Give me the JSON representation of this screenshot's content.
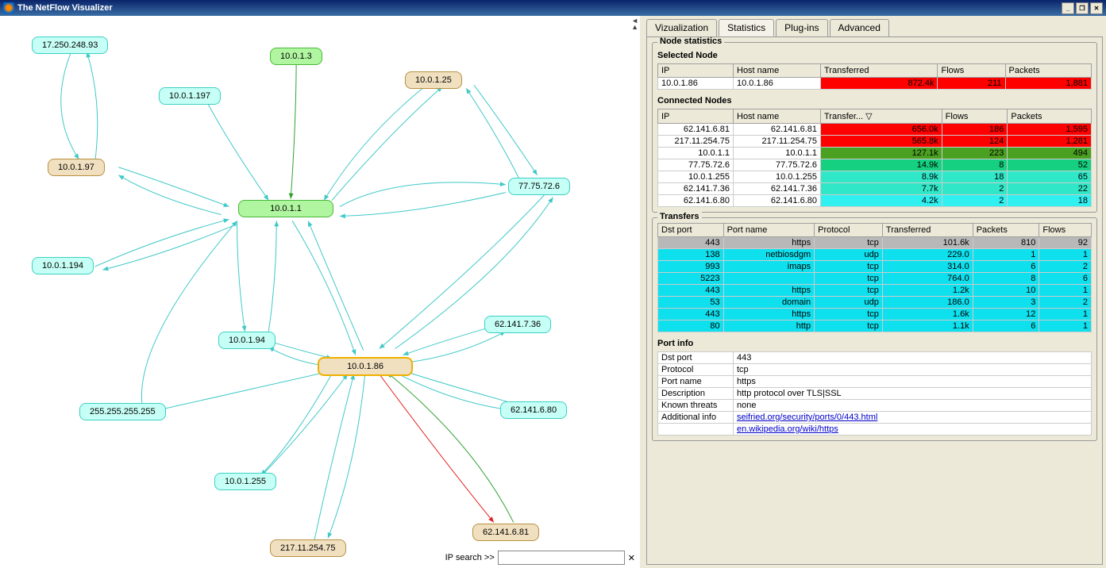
{
  "window": {
    "title": "The NetFlow Visualizer"
  },
  "tabs": {
    "vizualization": "Vizualization",
    "statistics": "Statistics",
    "plugins": "Plug-ins",
    "advanced": "Advanced",
    "active": "Statistics"
  },
  "nodeStats": {
    "title": "Node statistics",
    "selectedTitle": "Selected Node",
    "headers": {
      "ip": "IP",
      "host": "Host name",
      "transferred": "Transferred",
      "flows": "Flows",
      "packets": "Packets"
    },
    "selected": {
      "ip": "10.0.1.86",
      "host": "10.0.1.86",
      "transferred": "872.4k",
      "flows": "211",
      "packets": "1,881",
      "bg": "#ff0000"
    },
    "connectedTitle": "Connected Nodes",
    "connHeaders": {
      "ip": "IP",
      "host": "Host name",
      "transfer": "Transfer... ▽",
      "flows": "Flows",
      "packets": "Packets"
    },
    "connected": [
      {
        "ip": "62.141.6.81",
        "host": "62.141.6.81",
        "transfer": "656.0k",
        "flows": "186",
        "packets": "1,595",
        "bg": "#ff0000"
      },
      {
        "ip": "217.11.254.75",
        "host": "217.11.254.75",
        "transfer": "565.8k",
        "flows": "124",
        "packets": "1,281",
        "bg": "#ff0000"
      },
      {
        "ip": "10.0.1.1",
        "host": "10.0.1.1",
        "transfer": "127.1k",
        "flows": "223",
        "packets": "494",
        "bg": "#4aa020"
      },
      {
        "ip": "77.75.72.6",
        "host": "77.75.72.6",
        "transfer": "14.9k",
        "flows": "8",
        "packets": "52",
        "bg": "#14d080"
      },
      {
        "ip": "10.0.1.255",
        "host": "10.0.1.255",
        "transfer": "8.9k",
        "flows": "18",
        "packets": "65",
        "bg": "#30e8c8"
      },
      {
        "ip": "62.141.7.36",
        "host": "62.141.7.36",
        "transfer": "7.7k",
        "flows": "2",
        "packets": "22",
        "bg": "#30e8c8"
      },
      {
        "ip": "62.141.6.80",
        "host": "62.141.6.80",
        "transfer": "4.2k",
        "flows": "2",
        "packets": "18",
        "bg": "#30f0f0"
      }
    ]
  },
  "transfers": {
    "title": "Transfers",
    "headers": {
      "dst": "Dst port",
      "pname": "Port name",
      "proto": "Protocol",
      "transferred": "Transferred",
      "packets": "Packets",
      "flows": "Flows"
    },
    "rows": [
      {
        "dst": "443",
        "pname": "https",
        "proto": "tcp",
        "transferred": "101.6k",
        "packets": "810",
        "flows": "92",
        "bg": "#b8b8b8"
      },
      {
        "dst": "138",
        "pname": "netbiosdgm",
        "proto": "udp",
        "transferred": "229.0",
        "packets": "1",
        "flows": "1",
        "bg": "#0ee0ee"
      },
      {
        "dst": "993",
        "pname": "imaps",
        "proto": "tcp",
        "transferred": "314.0",
        "packets": "6",
        "flows": "2",
        "bg": "#0ee0ee"
      },
      {
        "dst": "5223",
        "pname": "",
        "proto": "tcp",
        "transferred": "764.0",
        "packets": "8",
        "flows": "6",
        "bg": "#0ee0ee"
      },
      {
        "dst": "443",
        "pname": "https",
        "proto": "tcp",
        "transferred": "1.2k",
        "packets": "10",
        "flows": "1",
        "bg": "#0ee0ee"
      },
      {
        "dst": "53",
        "pname": "domain",
        "proto": "udp",
        "transferred": "186.0",
        "packets": "3",
        "flows": "2",
        "bg": "#0ee0ee"
      },
      {
        "dst": "443",
        "pname": "https",
        "proto": "tcp",
        "transferred": "1.6k",
        "packets": "12",
        "flows": "1",
        "bg": "#0ee0ee"
      },
      {
        "dst": "80",
        "pname": "http",
        "proto": "tcp",
        "transferred": "1.1k",
        "packets": "6",
        "flows": "1",
        "bg": "#0ee0ee"
      }
    ]
  },
  "portInfo": {
    "title": "Port info",
    "labels": {
      "dst": "Dst port",
      "proto": "Protocol",
      "pname": "Port name",
      "desc": "Description",
      "threats": "Known threats",
      "addl": "Additional info"
    },
    "dst": "443",
    "proto": "tcp",
    "pname": "https",
    "desc": "http protocol over TLS|SSL",
    "threats": "none",
    "link1": "seifried.org/security/ports/0/443.html",
    "link2": "en.wikipedia.org/wiki/https"
  },
  "ipSearch": {
    "label": "IP search >>",
    "value": ""
  },
  "nodes": {
    "n17": "17.250.248.93",
    "n197": "10.0.1.197",
    "n3": "10.0.1.3",
    "n25": "10.0.1.25",
    "n97": "10.0.1.97",
    "n1": "10.0.1.1",
    "n77": "77.75.72.6",
    "n194": "10.0.1.194",
    "n94": "10.0.1.94",
    "n736": "62.141.7.36",
    "n86": "10.0.1.86",
    "n680": "62.141.6.80",
    "n255": "255.255.255.255",
    "n1255": "10.0.1.255",
    "n681": "62.141.6.81",
    "n217": "217.11.254.75"
  }
}
